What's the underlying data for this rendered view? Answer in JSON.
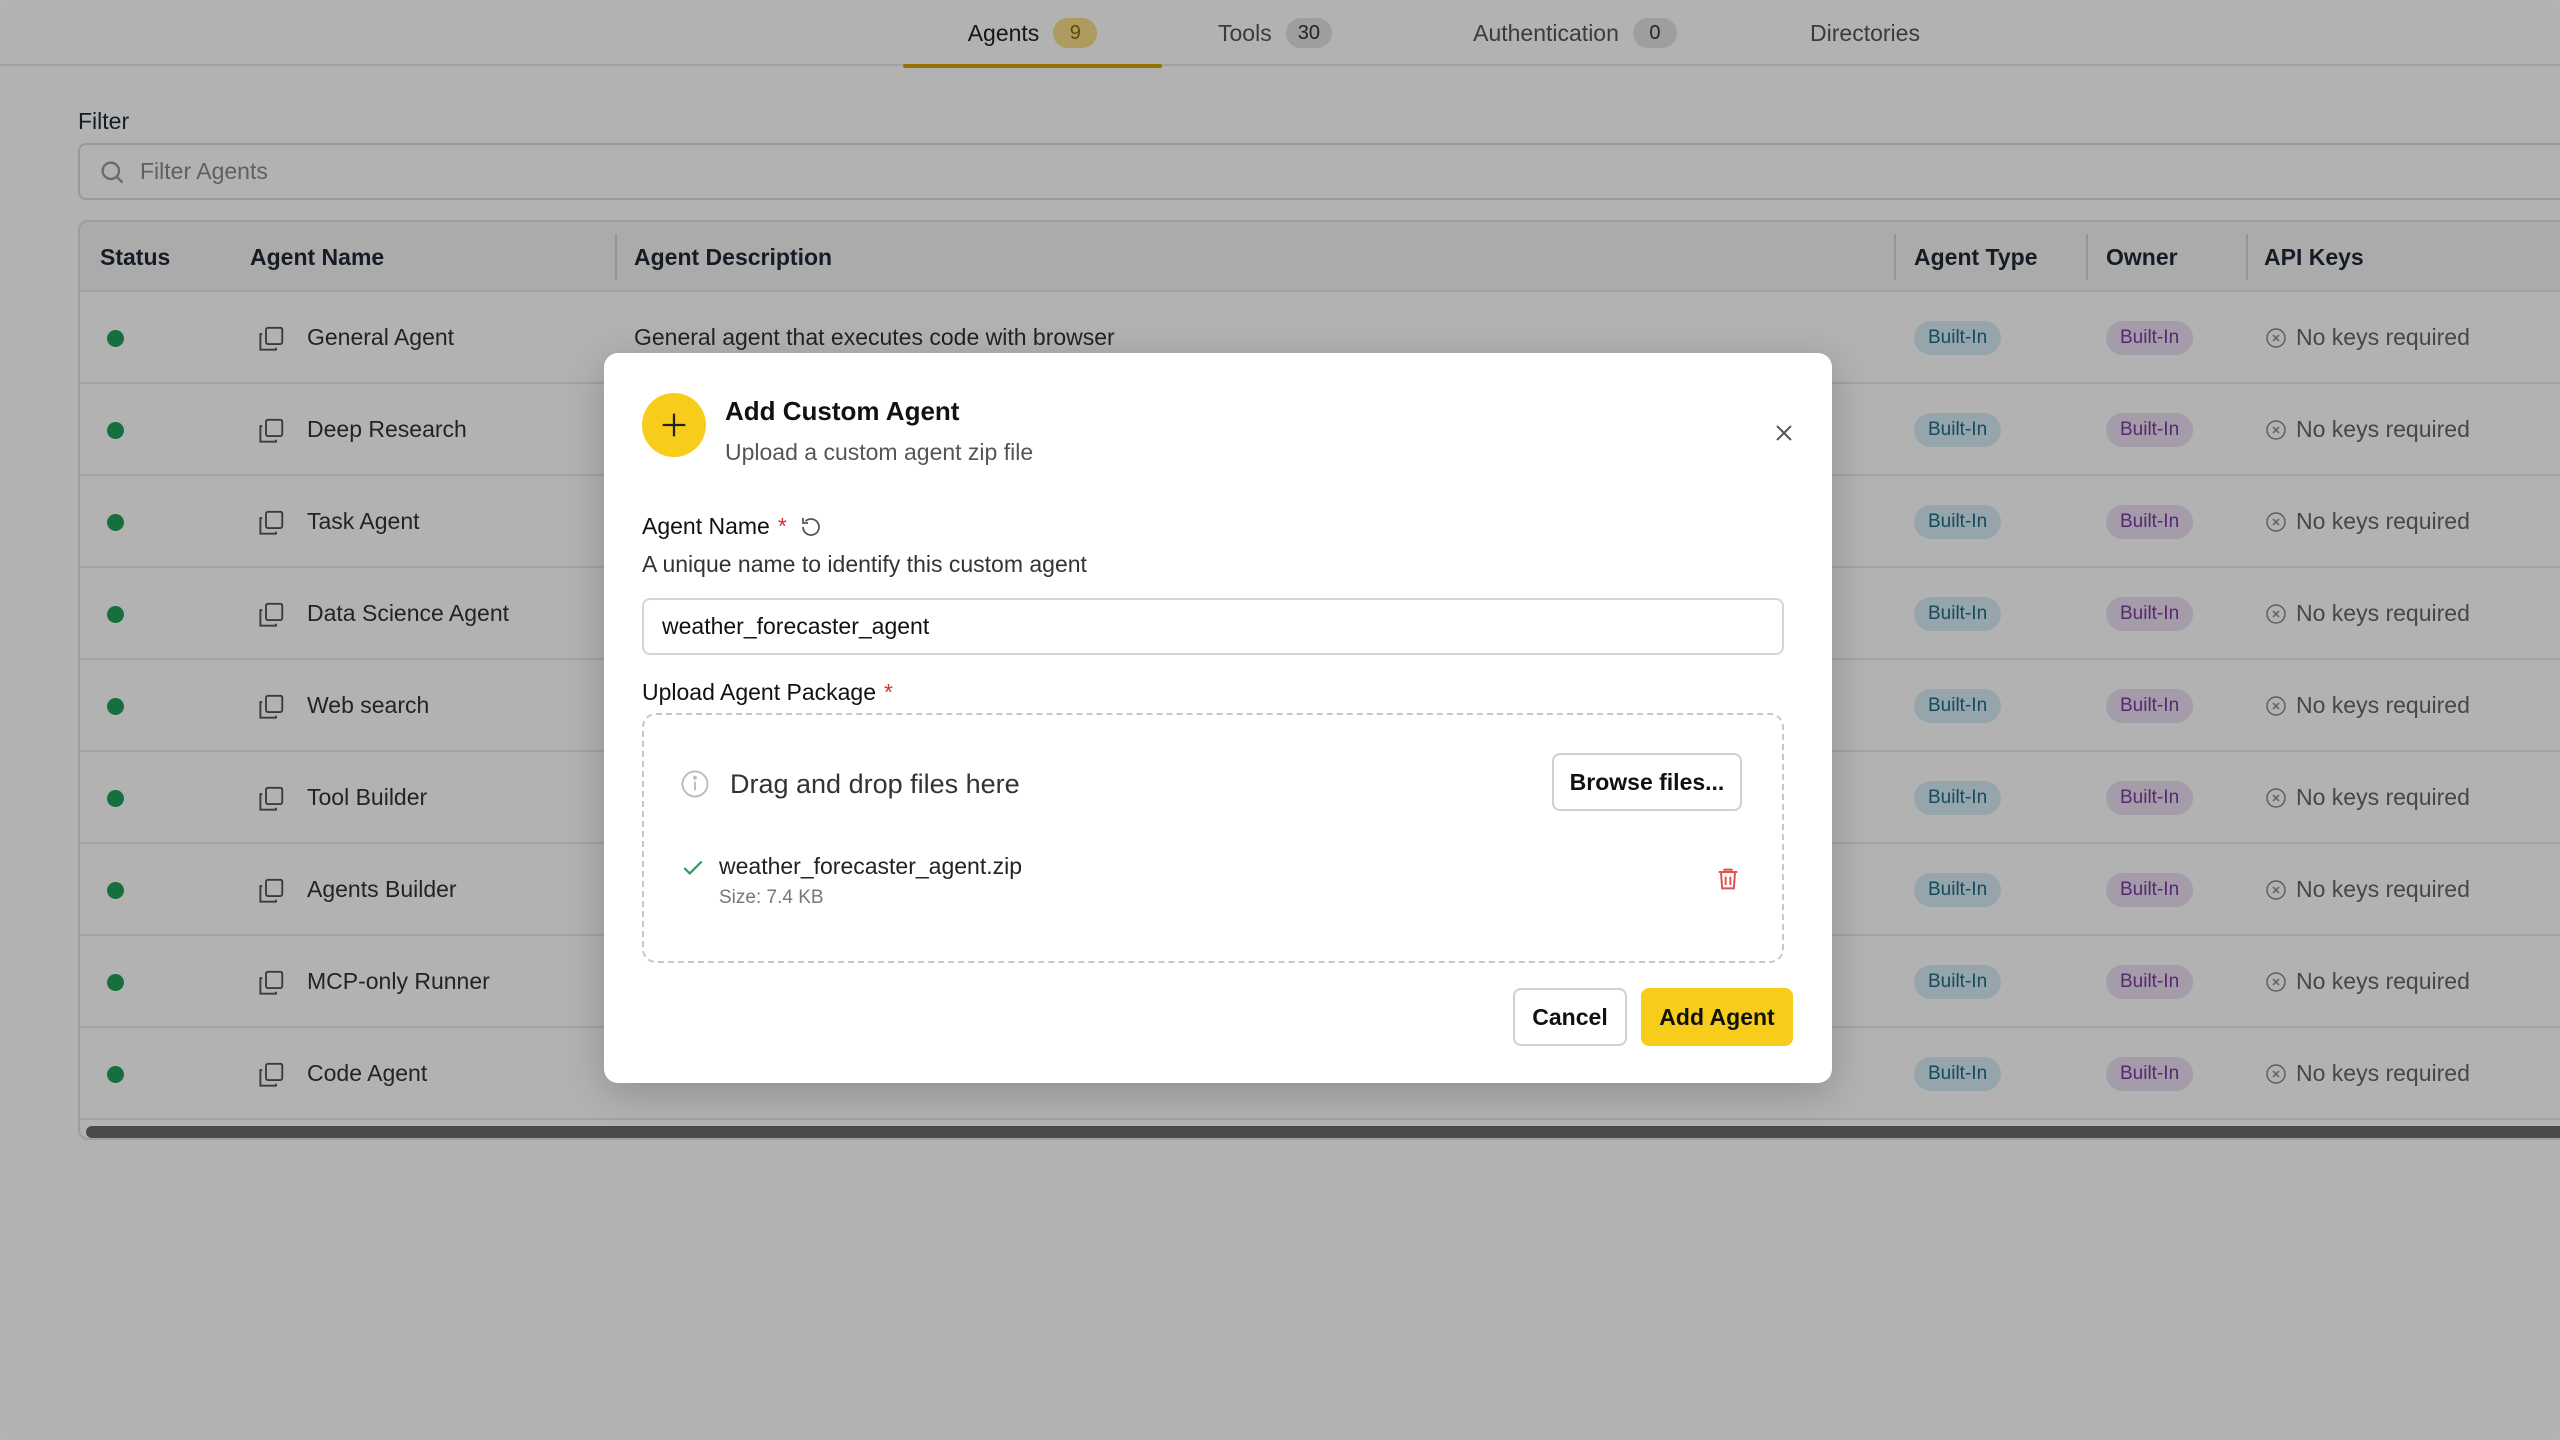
{
  "tabs": [
    {
      "label": "Agents",
      "count": "9"
    },
    {
      "label": "Tools",
      "count": "30"
    },
    {
      "label": "Authentication",
      "count": "0"
    },
    {
      "label": "Directories"
    }
  ],
  "filter": {
    "label": "Filter",
    "placeholder": "Filter Agents"
  },
  "table": {
    "columns": [
      "Status",
      "Agent Name",
      "Agent Description",
      "Agent Type",
      "Owner",
      "API Keys"
    ],
    "rows": [
      {
        "name": "General Agent",
        "description": "General agent that executes code with browser",
        "type": "Built-In",
        "owner": "Built-In",
        "keys": "No keys required"
      },
      {
        "name": "Deep Research",
        "description": "",
        "type": "Built-In",
        "owner": "Built-In",
        "keys": "No keys required"
      },
      {
        "name": "Task Agent",
        "description": "",
        "type": "Built-In",
        "owner": "Built-In",
        "keys": "No keys required"
      },
      {
        "name": "Data Science Agent",
        "description": "",
        "type": "Built-In",
        "owner": "Built-In",
        "keys": "No keys required"
      },
      {
        "name": "Web search",
        "description": "",
        "type": "Built-In",
        "owner": "Built-In",
        "keys": "No keys required"
      },
      {
        "name": "Tool Builder",
        "description": "",
        "type": "Built-In",
        "owner": "Built-In",
        "keys": "No keys required"
      },
      {
        "name": "Agents Builder",
        "description": "",
        "type": "Built-In",
        "owner": "Built-In",
        "keys": "No keys required"
      },
      {
        "name": "MCP-only Runner",
        "description": "",
        "type": "Built-In",
        "owner": "Built-In",
        "keys": "No keys required"
      },
      {
        "name": "Code Agent",
        "description": "",
        "type": "Built-In",
        "owner": "Built-In",
        "keys": "No keys required"
      }
    ]
  },
  "modal": {
    "title": "Add Custom Agent",
    "subtitle": "Upload a custom agent zip file",
    "name_label": "Agent Name",
    "required_mark": "*",
    "name_help": "A unique name to identify this custom agent",
    "name_value": "weather_forecaster_agent",
    "upload_label": "Upload Agent Package",
    "drop_text": "Drag and drop files here",
    "browse_label": "Browse files...",
    "file_name": "weather_forecaster_agent.zip",
    "file_size": "Size: 7.4 KB",
    "cancel_label": "Cancel",
    "add_label": "Add Agent"
  },
  "colors": {
    "accent": "#f8cc1b",
    "status_online": "#22a05a",
    "danger": "#d32f2f"
  }
}
